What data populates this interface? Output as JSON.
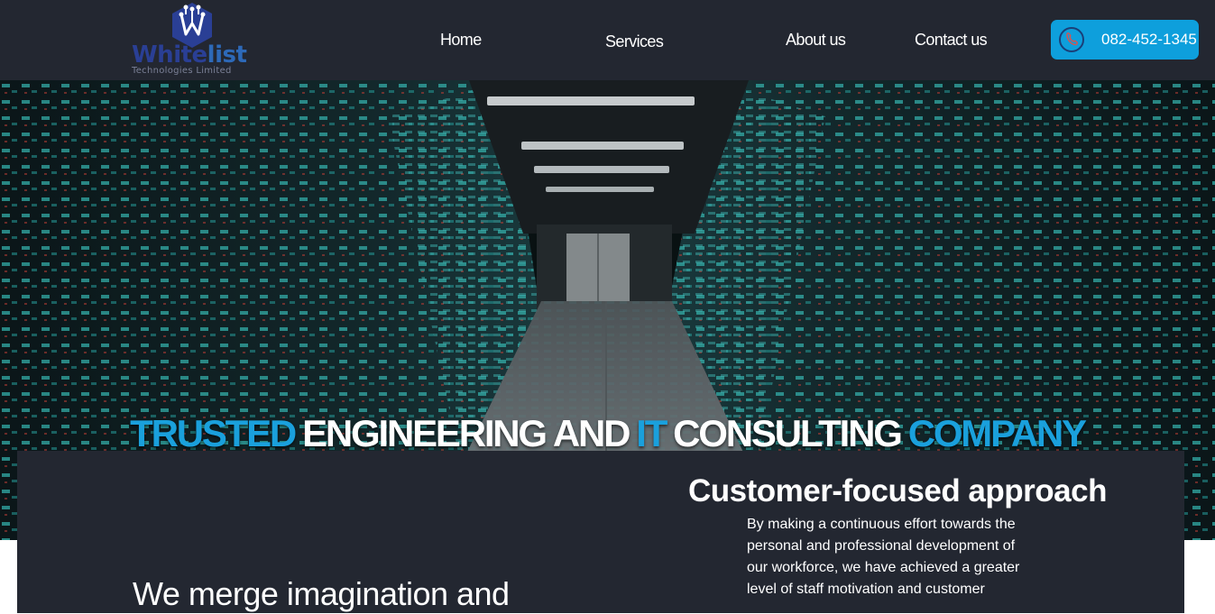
{
  "brand": {
    "name_main": "White",
    "name_accent": "list",
    "tagline": "Technologies Limited",
    "logo_icon": "circuit-w-icon",
    "color_primary": "#2a3f95",
    "color_accent": "#2d69b8"
  },
  "nav": {
    "items": [
      {
        "label": "Home"
      },
      {
        "label": "Services"
      },
      {
        "label": "About us"
      },
      {
        "label": "Contact us"
      }
    ],
    "phone": {
      "number": "082-452-1345",
      "icon": "phone-icon",
      "color": "#0e9fdc"
    }
  },
  "hero": {
    "title_words": [
      {
        "text": "TRUSTED",
        "color": "#1aa0dc"
      },
      {
        "text": "ENGINEERING AND",
        "color": "#ffffff"
      },
      {
        "text": "IT",
        "color": "#1aa0dc"
      },
      {
        "text": "CONSULTING",
        "color": "#ffffff"
      },
      {
        "text": "COMPANY",
        "color": "#1aa0dc"
      }
    ],
    "background": "server-room-image"
  },
  "feature": {
    "heading": "Customer-focused approach",
    "body": "By making a continuous effort towards the personal and professional development of our workforce, we have achieved a greater level of staff motivation and customer",
    "lead": "We merge imagination and"
  }
}
